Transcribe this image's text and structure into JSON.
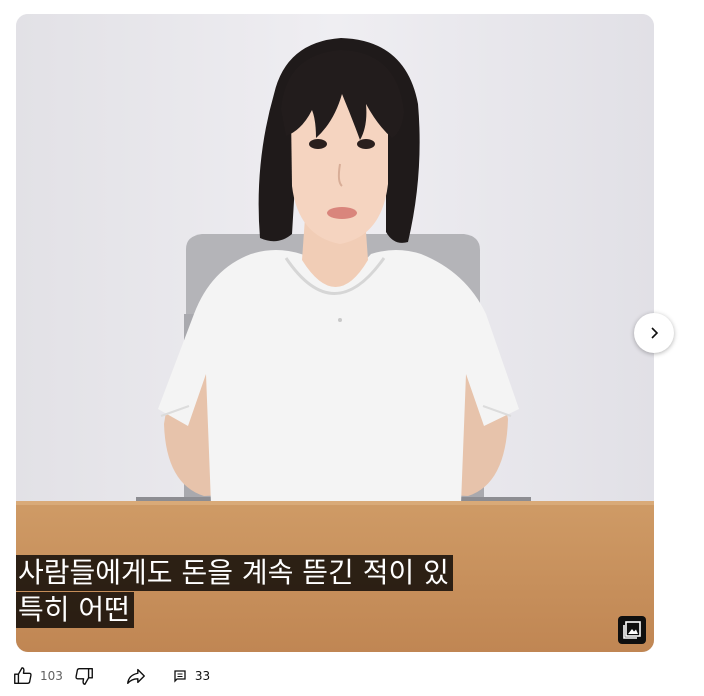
{
  "post": {
    "caption_line1": "사람들에게도 돈을 계속 뜯긴 적이 있",
    "caption_line2": "특히 어떤",
    "gallery_icon": "photo-gallery-icon",
    "next_icon": "chevron-right-icon"
  },
  "actions": {
    "like_count": "103",
    "comment_count": "33",
    "like_icon": "thumbs-up-icon",
    "dislike_icon": "thumbs-down-icon",
    "share_icon": "share-arrow-icon",
    "comment_icon": "comment-icon"
  },
  "colors": {
    "wall": "#e9e8ec",
    "desk": "#c8935e",
    "caption_bg": "#000000",
    "caption_text": "#ffffff"
  }
}
